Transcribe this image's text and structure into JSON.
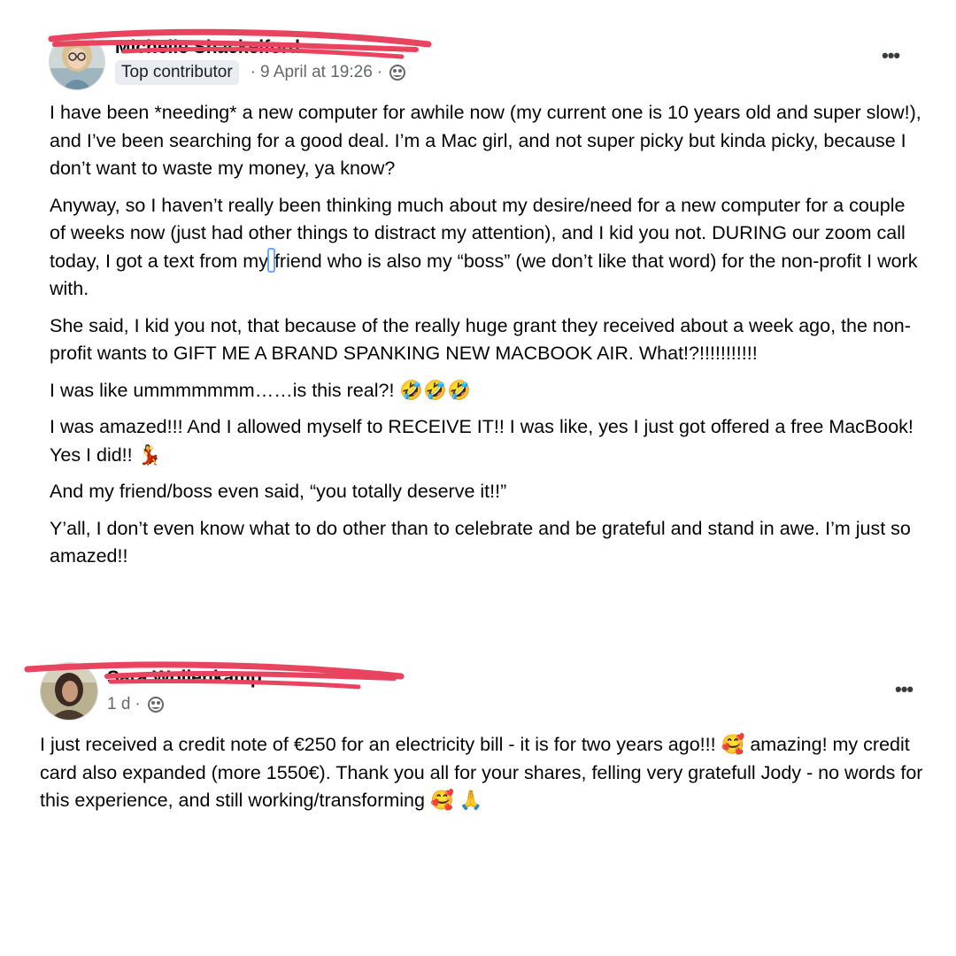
{
  "posts": [
    {
      "author": "Michelle Shackelford",
      "badge": "Top contributor",
      "timestamp": "9 April at 19:26",
      "separator": "·",
      "audience_icon": "globe-icon",
      "more_label": "•••",
      "paragraphs": [
        "I have been *needing* a new computer for awhile now (my current one is 10 years old and super slow!), and I’ve been searching for a good deal. I’m a Mac girl, and not super picky but kinda picky, because I don’t want to waste my money, ya know?",
        "Anyway, so I haven’t really been thinking much about my desire/need for a new computer for a couple of weeks now (just had other things to distract my attention), and I kid you not. DURING our zoom call today, I got a text from my",
        "friend who is also my “boss” (we don’t like that word) for the non-profit I work with.",
        "She said, I kid you not, that because of the really huge grant they received about a week ago, the non-profit wants to GIFT ME A BRAND SPANKING NEW MACBOOK AIR. What!?!!!!!!!!!!!",
        "I was like ummmmmmm……is this real?! 🤣🤣🤣",
        "I was amazed!!! And I allowed myself to RECEIVE IT!! I was like, yes I just got offered a free MacBook! Yes I did!! 💃",
        "And my friend/boss even said, “you totally deserve it!!”",
        "Y’all, I don’t even know what to do other than to celebrate and be grateful and stand in awe. I’m just so amazed!!"
      ]
    },
    {
      "author": "Sara Wollenkamp",
      "timestamp": "1 d",
      "separator": "·",
      "audience_icon": "globe-icon",
      "more_label": "•••",
      "paragraphs": [
        "I just received a credit note of €250 for an electricity bill -  it is for two years ago!!! 🥰 amazing!  my credit card also expanded (more 1550€). Thank you all for your shares, felling very gratefull Jody - no words for this experience, and still working/transforming 🥰 🙏"
      ]
    }
  ],
  "colors": {
    "scribble": "#e8435f",
    "meta_text": "#65676b",
    "badge_bg": "#e9ecf1",
    "cursor": "#6ea6ff"
  }
}
